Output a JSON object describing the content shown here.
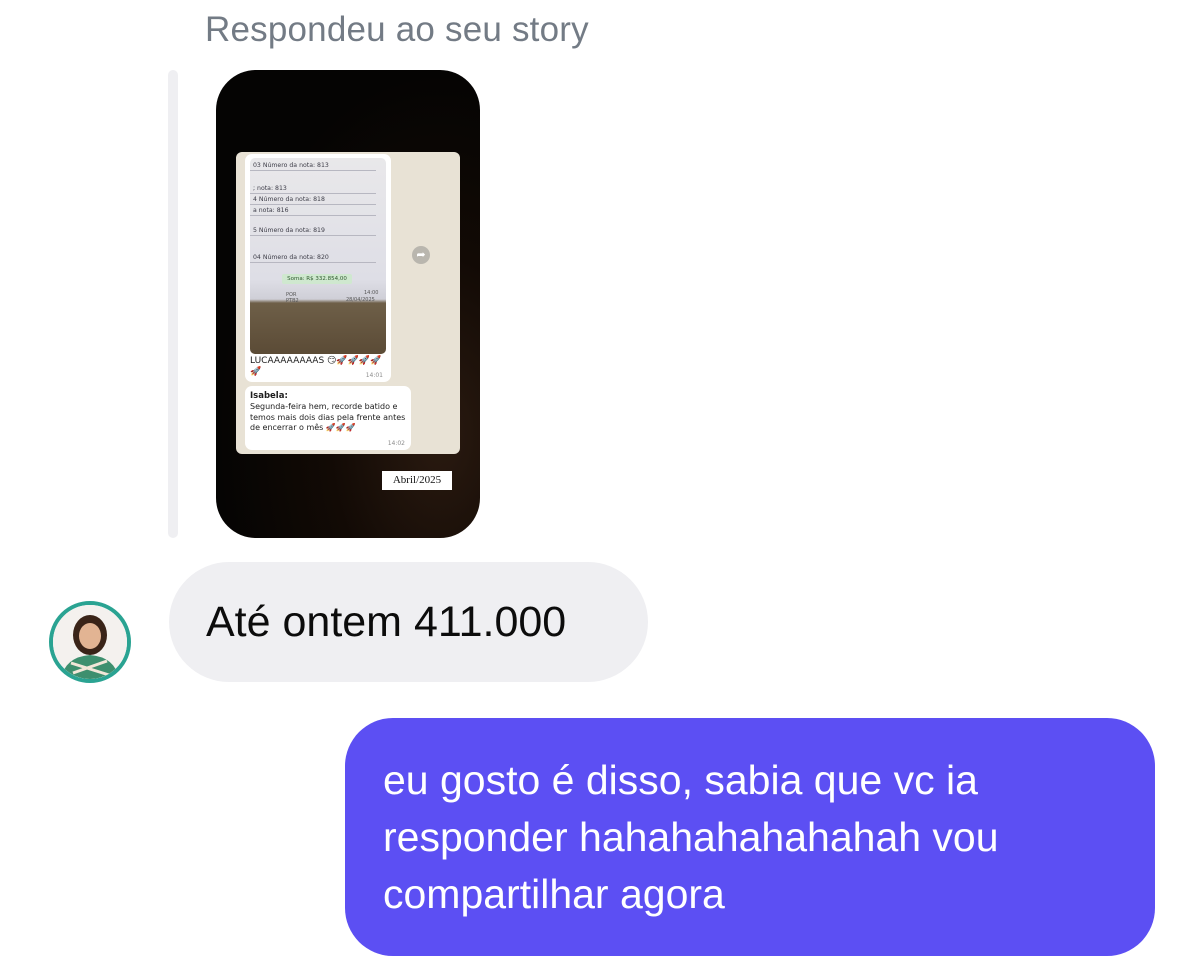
{
  "conversation": {
    "reply_label": "Respondeu ao seu story",
    "story": {
      "whatsapp_photo_lines": [
        "03 Número da nota: 813",
        "; nota: 813",
        "4 Número da nota: 818",
        "a nota: 816",
        "5 Número da nota: 819",
        "04 Número da nota: 820"
      ],
      "whatsapp_sum_chip": "Soma: R$ 332.854,00",
      "whatsapp_taskbar_lang": "POR PTB2",
      "whatsapp_taskbar_time": "14:00",
      "whatsapp_taskbar_date": "28/04/2025",
      "whatsapp_caption": "LUCAAAAAAAAS 😏🚀🚀🚀🚀🚀",
      "whatsapp_caption_time": "14:01",
      "whatsapp_reply_sender": "Isabela:",
      "whatsapp_reply_text": "Segunda-feira hem, recorde batido e temos mais dois dias pela frente antes de encerrar o mês 🚀🚀🚀",
      "whatsapp_reply_time": "14:02",
      "date_badge": "Abril/2025"
    },
    "incoming_message": "Até ontem 411.000",
    "outgoing_message": "eu gosto é disso, sabia que vc ia responder hahahahahahahah vou compartilhar agora"
  },
  "colors": {
    "outgoing_bubble": "#5c4ff3",
    "incoming_bubble": "#efeff2",
    "avatar_ring": "#2aa392",
    "label_gray": "#737b85"
  }
}
